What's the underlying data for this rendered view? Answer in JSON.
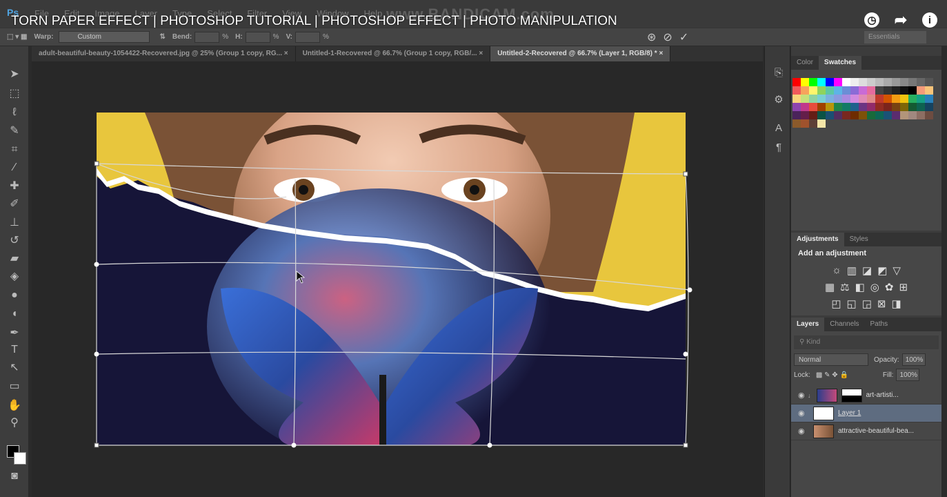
{
  "app": {
    "logo": "Ps",
    "menu": [
      "File",
      "Edit",
      "Image",
      "Layer",
      "Type",
      "Select",
      "Filter",
      "View",
      "Window",
      "Help"
    ],
    "recorder_watermark": "www.BANDICAM.com"
  },
  "video": {
    "title": "TORN PAPER EFFECT | PHOTOSHOP TUTORIAL | PHOTOSHOP EFFECT | PHOTO MANIPULATION",
    "icons": [
      "clock-icon",
      "share-icon",
      "info-icon"
    ]
  },
  "options_bar": {
    "warp_label": "Warp:",
    "warp_value": "Custom",
    "bend_label": "Bend:",
    "h_label": "H:",
    "v_label": "V:",
    "pct": "%",
    "workspace": "Essentials"
  },
  "tabs": [
    {
      "label": "adult-beautiful-beauty-1054422-Recovered.jpg @ 25% (Group 1 copy, RG...",
      "close": "×"
    },
    {
      "label": "Untitled-1-Recovered @ 66.7% (Group 1 copy, RGB/...",
      "close": "×"
    },
    {
      "label": "Untitled-2-Recovered @ 66.7% (Layer 1, RGB/8) *",
      "close": "×"
    }
  ],
  "panels": {
    "color_tabs": [
      "Color",
      "Swatches"
    ],
    "adjustments_tabs": [
      "Adjustments",
      "Styles"
    ],
    "adjustments_title": "Add an adjustment",
    "layers_tabs": [
      "Layers",
      "Channels",
      "Paths"
    ],
    "filter_kind": "Kind",
    "blend_mode": "Normal",
    "opacity_label": "Opacity:",
    "opacity_value": "100%",
    "lock_label": "Lock:",
    "fill_label": "Fill:",
    "fill_value": "100%",
    "layers": [
      {
        "name": "art-artisti...",
        "selected": false
      },
      {
        "name": "Layer 1",
        "selected": true
      },
      {
        "name": "attractive-beautiful-bea...",
        "selected": false
      }
    ]
  },
  "colors": {
    "accent": "#e8c63d",
    "selection": "#5e6c80"
  }
}
